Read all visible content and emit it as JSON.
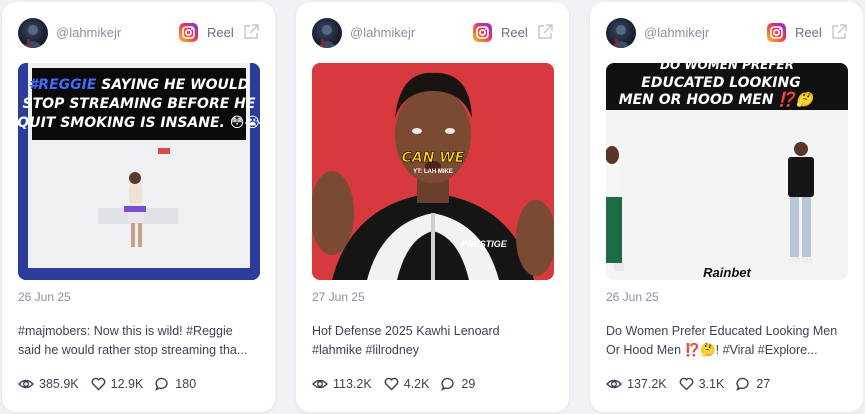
{
  "cards": [
    {
      "handle": "@lahmikejr",
      "platform": "Reel",
      "date": "26 Jun 25",
      "caption_line1": "#majmobers: Now this is wild! #Reggie",
      "caption_line2": "said he would rather stop streaming tha...",
      "views": "385.9K",
      "likes": "12.9K",
      "comments": "180",
      "thumb_hashtag": "#REGGIE",
      "thumb_line1": " SAYING HE WOULD",
      "thumb_line2": "STOP STREAMING BEFORE HE",
      "thumb_line3": "QUIT SMOKING IS INSANE. 😳😭"
    },
    {
      "handle": "@lahmikejr",
      "platform": "Reel",
      "date": "27 Jun 25",
      "caption_line1": "Hof Defense 2025 Kawhi Lenoard",
      "caption_line2": "#lahmike #lilrodney",
      "views": "113.2K",
      "likes": "4.2K",
      "comments": "29",
      "thumb_caption": "CAN WE",
      "thumb_watermark": "YT: LAH MIKE",
      "thumb_brand": "PRESTIGE"
    },
    {
      "handle": "@lahmikejr",
      "platform": "Reel",
      "date": "26 Jun 25",
      "caption_line1": "Do Women Prefer Educated Looking Men",
      "caption_line2": "Or Hood Men ⁉️🤔! #Viral #Explore...",
      "views": "137.2K",
      "likes": "3.1K",
      "comments": "27",
      "thumb_line1": "DO WOMEN PREFER",
      "thumb_line2": "EDUCATED LOOKING",
      "thumb_line3": "MEN OR HOOD MEN ⁉️🤔",
      "thumb_sponsor": "Rainbet"
    }
  ],
  "colors": {
    "accent_instagram": "#e1306c",
    "text_muted": "#8a8fa3",
    "text_body": "#3c4256",
    "thumb1_frame": "#2c3c9a",
    "thumb2_bg": "#d8393f",
    "thumb3_banner": "#111111"
  }
}
